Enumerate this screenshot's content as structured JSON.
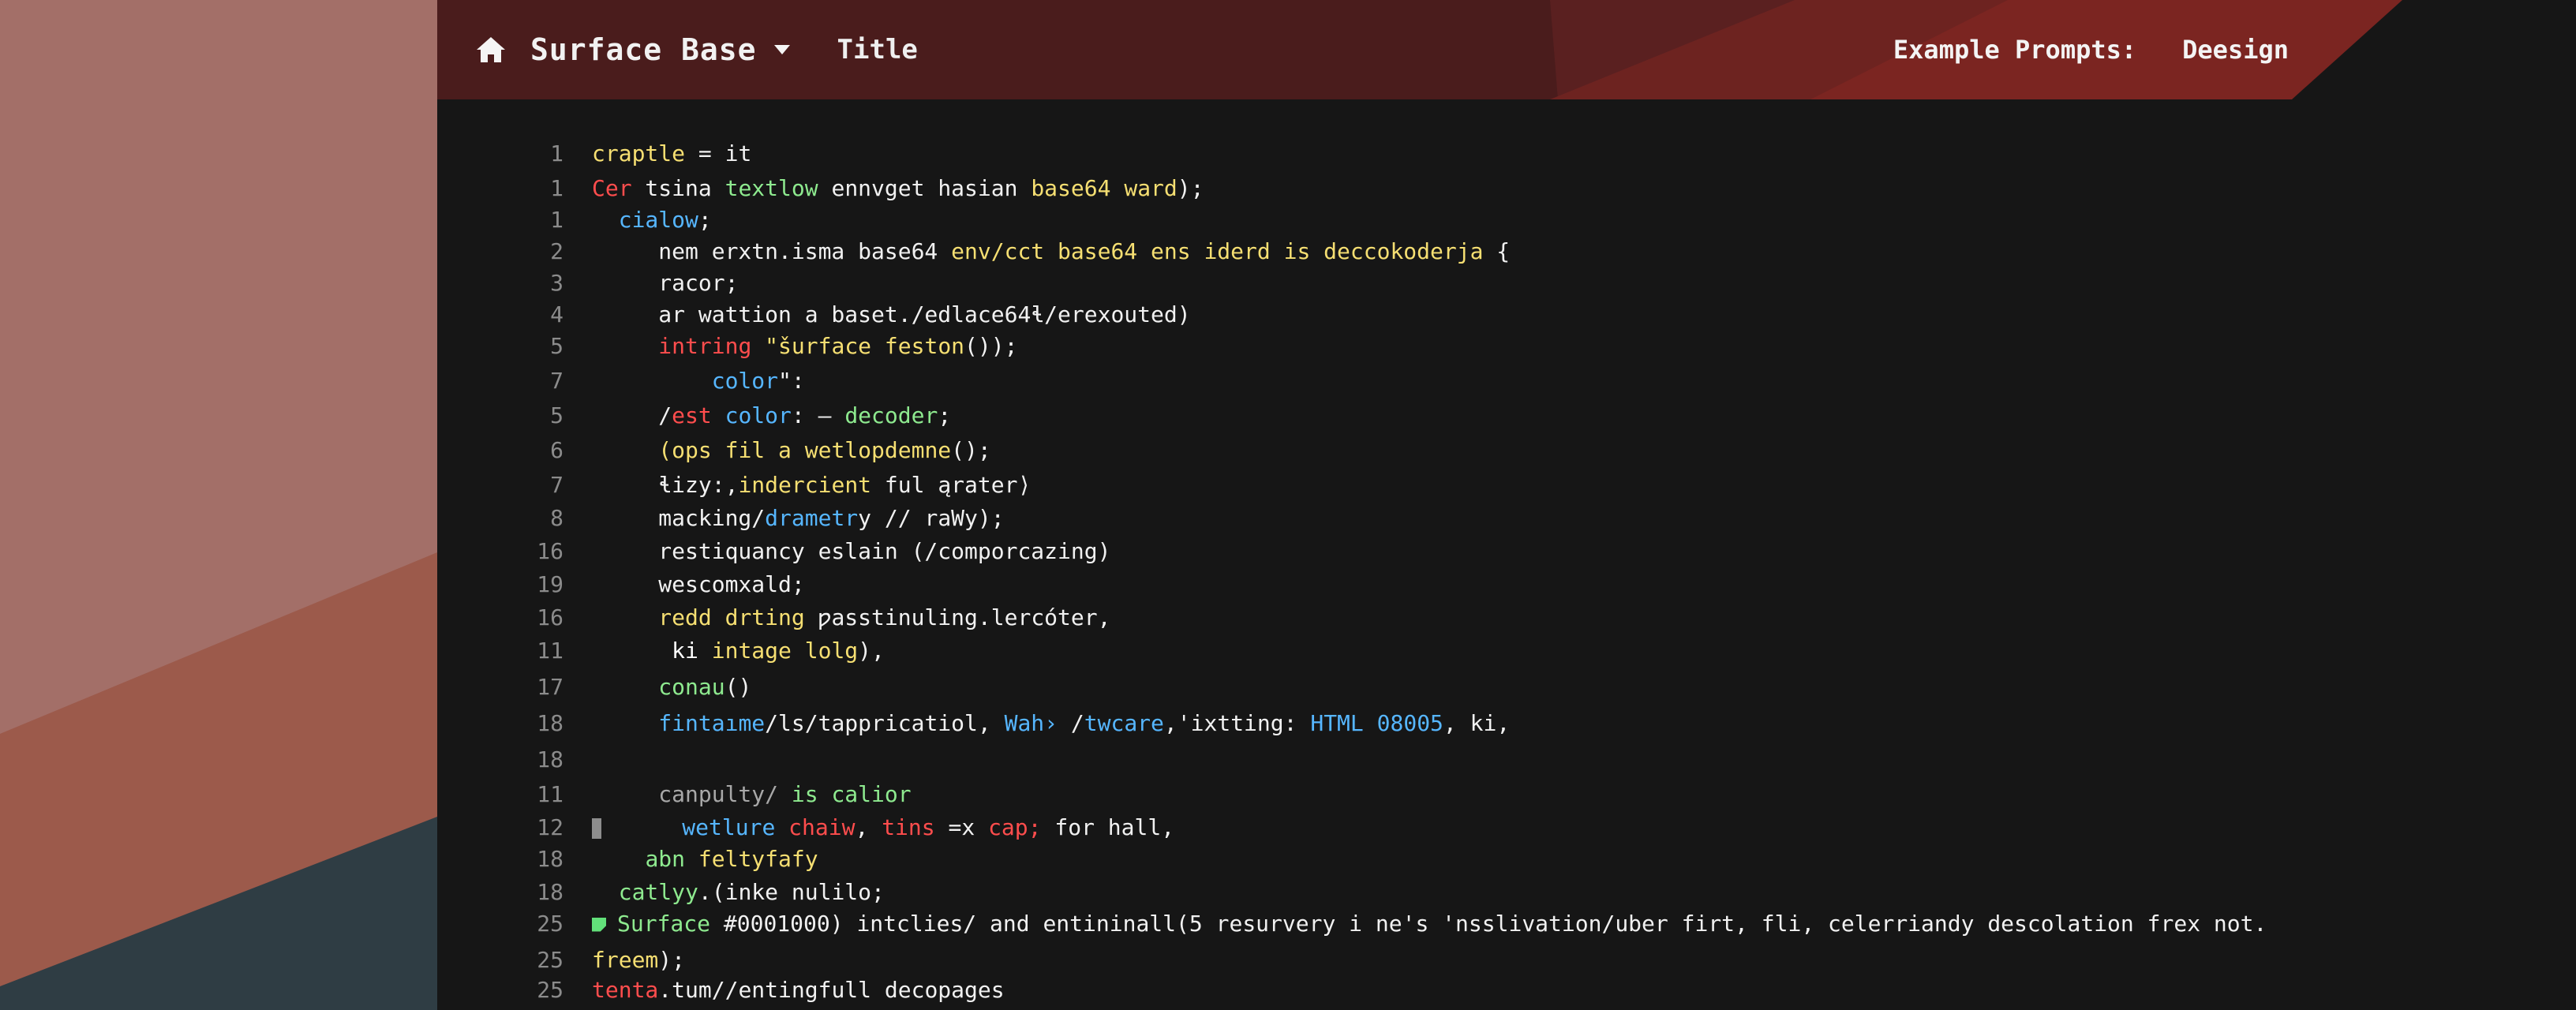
{
  "header": {
    "project_name": "Surface Base",
    "title_label": "Title",
    "prompts_label": "Example Prompts:",
    "design_label": "Deesign"
  },
  "icons": {
    "home": "home-icon",
    "caret": "chevron-down-icon",
    "gutter_marker": "gutter-marker-icon",
    "file_marker": "file-marker-icon"
  },
  "colors": {
    "header_dark": "#4a1c1c",
    "header_light": "#7b2521",
    "editor_bg": "#161616",
    "desktop_salmon": "#a36f68",
    "desktop_coral": "#9c5a4b",
    "desktop_slate": "#2f3d44",
    "token_yellow": "#f6df72",
    "token_red": "#ff4d4d",
    "token_green": "#8eea8f",
    "token_blue": "#56b6ff",
    "token_default": "#f1f1f1"
  },
  "code": {
    "lines": [
      {
        "number": "1",
        "segments": [
          {
            "text": "craptle",
            "class": "tok-yellow"
          },
          {
            "text": " = ",
            "class": "tok-default"
          },
          {
            "text": "it",
            "class": "tok-default"
          }
        ]
      },
      {
        "number": "1",
        "segments": [
          {
            "text": "Cer",
            "class": "tok-red"
          },
          {
            "text": " tsina ",
            "class": "tok-default"
          },
          {
            "text": "textlow",
            "class": "tok-green"
          },
          {
            "text": " ennvget hasian ",
            "class": "tok-default"
          },
          {
            "text": "base64 ward",
            "class": "tok-yellow"
          },
          {
            "text": ");",
            "class": "tok-default"
          }
        ]
      },
      {
        "number": "1",
        "segments": [
          {
            "text": "  ",
            "class": "tok-default"
          },
          {
            "text": "cialow",
            "class": "tok-blue"
          },
          {
            "text": ";",
            "class": "tok-default"
          }
        ]
      },
      {
        "number": "2",
        "segments": [
          {
            "text": "     nem erxtn.isma base64 ",
            "class": "tok-default"
          },
          {
            "text": "env/cct base64 ens iderd is deccokoderja",
            "class": "tok-yellow"
          },
          {
            "text": " {",
            "class": "tok-default"
          }
        ]
      },
      {
        "number": "3",
        "segments": [
          {
            "text": "     racor;",
            "class": "tok-default"
          }
        ]
      },
      {
        "number": "4",
        "segments": [
          {
            "text": "     ar wattion a baset./edlace64",
            "class": "tok-default"
          },
          {
            "text": "ɬ",
            "class": "tok-default"
          },
          {
            "text": "/erexouted)",
            "class": "tok-default"
          }
        ]
      },
      {
        "number": "5",
        "segments": [
          {
            "text": "     ",
            "class": "tok-default"
          },
          {
            "text": "intring",
            "class": "tok-red"
          },
          {
            "text": " \"",
            "class": "tok-yellow"
          },
          {
            "text": "šurface feston",
            "class": "tok-yellow"
          },
          {
            "text": "());",
            "class": "tok-default"
          }
        ]
      },
      {
        "number": "7",
        "segments": [
          {
            "text": "         ",
            "class": "tok-default"
          },
          {
            "text": "color",
            "class": "tok-blue"
          },
          {
            "text": "\":",
            "class": "tok-default"
          }
        ]
      },
      {
        "number": "5",
        "segments": [
          {
            "text": "     /",
            "class": "tok-default"
          },
          {
            "text": "est",
            "class": "tok-red"
          },
          {
            "text": " ",
            "class": "tok-default"
          },
          {
            "text": "color",
            "class": "tok-blue"
          },
          {
            "text": ": – ",
            "class": "tok-default"
          },
          {
            "text": "decoder",
            "class": "tok-green"
          },
          {
            "text": ";",
            "class": "tok-default"
          }
        ]
      },
      {
        "number": "6",
        "segments": [
          {
            "text": "     ",
            "class": "tok-default"
          },
          {
            "text": "(ops fil a wetlopdemne",
            "class": "tok-yellow"
          },
          {
            "text": "();",
            "class": "tok-default"
          }
        ]
      },
      {
        "number": "7",
        "segments": [
          {
            "text": "     ",
            "class": "tok-default"
          },
          {
            "text": "ɬizy:,",
            "class": "tok-default"
          },
          {
            "text": "indercient",
            "class": "tok-yellow"
          },
          {
            "text": " ful ",
            "class": "tok-default"
          },
          {
            "text": "ąrater",
            "class": "tok-default"
          },
          {
            "text": "⟩",
            "class": "tok-default"
          }
        ]
      },
      {
        "number": "8",
        "segments": [
          {
            "text": "     macking/",
            "class": "tok-default"
          },
          {
            "text": "drametr",
            "class": "tok-blue"
          },
          {
            "text": "y // raWy);",
            "class": "tok-default"
          }
        ]
      },
      {
        "number": "16",
        "segments": [
          {
            "text": "     restiquancy eslain (/comporcazing)",
            "class": "tok-default"
          }
        ]
      },
      {
        "number": "19",
        "segments": [
          {
            "text": "     wescomxald;",
            "class": "tok-default"
          }
        ]
      },
      {
        "number": "16",
        "segments": [
          {
            "text": "     ",
            "class": "tok-default"
          },
          {
            "text": "redd drting",
            "class": "tok-yellow"
          },
          {
            "text": " ",
            "class": "tok-default"
          },
          {
            "text": "ƿasstinuling.lercóter,",
            "class": "tok-default"
          }
        ]
      },
      {
        "number": "11",
        "segments": [
          {
            "text": "      ",
            "class": "tok-default"
          },
          {
            "text": "ki",
            "class": "tok-white"
          },
          {
            "text": " intage lolg",
            "class": "tok-yellow"
          },
          {
            "text": "),",
            "class": "tok-default"
          }
        ]
      },
      {
        "number": "17",
        "segments": [
          {
            "text": "     ",
            "class": "tok-default"
          },
          {
            "text": "conau",
            "class": "tok-green"
          },
          {
            "text": "()",
            "class": "tok-default"
          }
        ]
      },
      {
        "number": "18",
        "segments": [
          {
            "text": "     ",
            "class": "tok-default"
          },
          {
            "text": "fintaıme",
            "class": "tok-blue"
          },
          {
            "text": "/ls/tappricatiol, ",
            "class": "tok-default"
          },
          {
            "text": "Wah›",
            "class": "tok-blue"
          },
          {
            "text": " /",
            "class": "tok-default"
          },
          {
            "text": "twcare",
            "class": "tok-blue"
          },
          {
            "text": ",'ixtting: ",
            "class": "tok-default"
          },
          {
            "text": "HTML 08005",
            "class": "tok-blue"
          },
          {
            "text": ", ki,",
            "class": "tok-default"
          }
        ]
      },
      {
        "number": "18",
        "segments": []
      },
      {
        "number": "11",
        "segments": [
          {
            "text": "     canpulty/",
            "class": "tok-comment"
          },
          {
            "text": " is calior",
            "class": "tok-green"
          }
        ]
      },
      {
        "number": "12",
        "segments": [
          {
            "text": "     ",
            "class": "tok-default"
          },
          {
            "text": "wetlure",
            "class": "tok-blue"
          },
          {
            "text": " ",
            "class": "tok-default"
          },
          {
            "text": "chaiw",
            "class": "tok-red"
          },
          {
            "text": ", ",
            "class": "tok-default"
          },
          {
            "text": "tins",
            "class": "tok-red"
          },
          {
            "text": " =x ",
            "class": "tok-default"
          },
          {
            "text": "cap;",
            "class": "tok-red"
          },
          {
            "text": " for hall,",
            "class": "tok-default"
          }
        ]
      },
      {
        "number": "18",
        "segments": [
          {
            "text": "    ",
            "class": "tok-default"
          },
          {
            "text": "abn",
            "class": "tok-green"
          },
          {
            "text": " ",
            "class": "tok-default"
          },
          {
            "text": "feltyfafy",
            "class": "tok-yellow"
          }
        ]
      },
      {
        "number": "18",
        "segments": [
          {
            "text": "  ",
            "class": "tok-default"
          },
          {
            "text": "catlyy",
            "class": "tok-green"
          },
          {
            "text": ".(inke nulilo;",
            "class": "tok-default"
          }
        ]
      },
      {
        "number": "25",
        "segments": [
          {
            "text": "Surface",
            "class": "tok-green"
          },
          {
            "text": " #0001000) intclies/ and entininall(5 resurvery i ne's 'nsslivation/uber firt, fli, celerriandy descolation frex not.",
            "class": "tok-default"
          }
        ]
      },
      {
        "number": "25",
        "segments": [
          {
            "text": "freem",
            "class": "tok-yellow"
          },
          {
            "text": ");",
            "class": "tok-default"
          }
        ]
      },
      {
        "number": "25",
        "segments": [
          {
            "text": "tenta",
            "class": "tok-red"
          },
          {
            "text": ".tum//entingfull decopages",
            "class": "tok-default"
          }
        ]
      }
    ]
  }
}
